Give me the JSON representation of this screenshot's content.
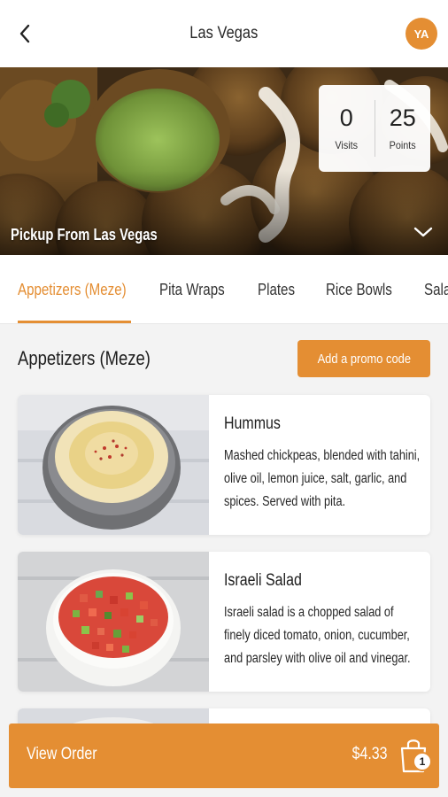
{
  "header": {
    "title": "Las Vegas",
    "avatar_initials": "YA",
    "back_icon": "chevron-left-icon"
  },
  "hero": {
    "pickup_label": "Pickup From Las Vegas",
    "stats": [
      {
        "value": "0",
        "label": "Visits"
      },
      {
        "value": "25",
        "label": "Points"
      }
    ],
    "expand_icon": "chevron-down-icon"
  },
  "tabs": [
    {
      "label": "Appetizers (Meze)",
      "active": true
    },
    {
      "label": "Pita Wraps",
      "active": false
    },
    {
      "label": "Plates",
      "active": false
    },
    {
      "label": "Rice Bowls",
      "active": false
    },
    {
      "label": "Salads",
      "active": false
    }
  ],
  "section": {
    "title": "Appetizers (Meze)",
    "promo_button": "Add a promo code"
  },
  "items": [
    {
      "name": "Hummus",
      "description": "Mashed chickpeas, blended with tahini, olive oil, lemon juice, salt, garlic, and spices. Served with pita."
    },
    {
      "name": "Israeli Salad",
      "description": "Israeli salad is a chopped salad of finely diced tomato, onion, cucumber, and parsley with olive oil and vinegar."
    }
  ],
  "order_bar": {
    "label": "View Order",
    "total": "$4.33",
    "item_count": "1",
    "bag_icon": "shopping-bag-icon"
  },
  "colors": {
    "accent": "#e48e33",
    "background": "#f3f3f3"
  }
}
